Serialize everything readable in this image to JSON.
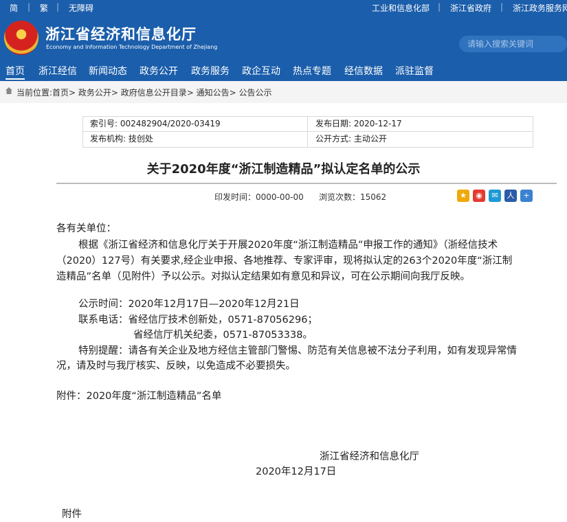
{
  "topbar": {
    "simplified": "简",
    "traditional": "繁",
    "accessibility": "无障碍",
    "link1": "工业和信息化部",
    "link2": "浙江省政府",
    "link3": "浙江政务服务网"
  },
  "header": {
    "title": "浙江省经济和信息化厅",
    "subtitle": "Economy and Information Technology Department of Zhejiang",
    "search_placeholder": "请输入搜索关键词"
  },
  "nav": [
    "首页",
    "浙江经信",
    "新闻动态",
    "政务公开",
    "政务服务",
    "政企互动",
    "热点专题",
    "经信数据",
    "派驻监督"
  ],
  "breadcrumb": "当前位置:首页> 政务公开> 政府信息公开目录> 通知公告> 公告公示",
  "meta": {
    "index": "索引号: 002482904/2020-03419",
    "date": "发布日期: 2020-12-17",
    "org": "发布机构: 技创处",
    "mode": "公开方式: 主动公开"
  },
  "article": {
    "title": "关于2020年度“浙江制造精品”拟认定名单的公示",
    "print_time": "印发时间：0000-00-00",
    "views": "浏览次数：15062",
    "lines": [
      "各有关单位：",
      "根据《浙江省经济和信息化厅关于开展2020年度“浙江制造精品”申报工作的通知》（浙经信技术",
      "（2020）127号）有关要求,经企业申报、各地推荐、专家评审，现将拟认定的263个2020年度“浙江制",
      "造精品”名单（见附件）予以公示。对拟认定结果如有意见和异议，可在公示期间向我厅反映。",
      "公示时间：2020年12月17日—2020年12月21日",
      "联系电话：省经信厅技术创新处，0571-87056296；",
      "省经信厅机关纪委，0571-87053338。",
      "特别提醒：请各有关企业及地方经信主管部门警惕、防范有关信息被不法分子利用，如有发现异常情",
      "况，请及时与我厅核实、反映，以免造成不必要损失。",
      "附件：2020年度“浙江制造精品”名单",
      "浙江省经济和信息化厅",
      "2020年12月17日",
      "附件"
    ]
  }
}
